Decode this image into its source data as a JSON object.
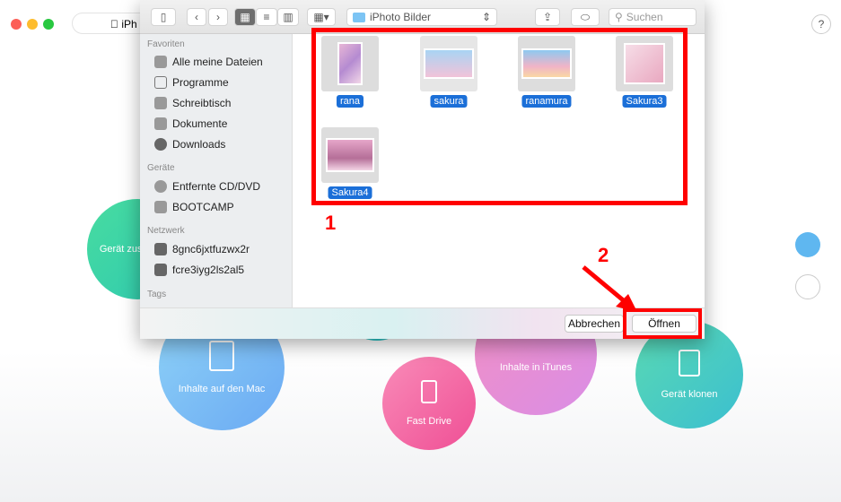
{
  "app": {
    "device_tab": "iPh",
    "help": "?"
  },
  "circles": [
    {
      "label": "Gerät zusammen",
      "color": "#3dd4a3"
    },
    {
      "label": "Inhalte auf den Mac",
      "color": "#7cc6f5"
    },
    {
      "label": "Fast Drive",
      "color": "#f46aa8"
    },
    {
      "label": "Inhalte in iTunes",
      "color": "#e98ad9"
    },
    {
      "label": "Gerät klonen",
      "color": "#4fd0b5"
    }
  ],
  "dialog": {
    "location": "iPhoto Bilder",
    "search_placeholder": "Suchen",
    "sidebar": {
      "favorites_header": "Favoriten",
      "favorites": [
        "Alle meine Dateien",
        "Programme",
        "Schreibtisch",
        "Dokumente",
        "Downloads"
      ],
      "devices_header": "Geräte",
      "devices": [
        "Entfernte CD/DVD",
        "BOOTCAMP"
      ],
      "network_header": "Netzwerk",
      "network": [
        "8gnc6jxtfuzwx2r",
        "fcre3iyg2ls2al5"
      ],
      "tags_header": "Tags"
    },
    "files": [
      "rana",
      "sakura",
      "ranamura",
      "Sakura3",
      "Sakura4"
    ],
    "cancel": "Abbrechen",
    "open": "Öffnen"
  },
  "annotations": {
    "step1": "1",
    "step2": "2",
    "color": "#ff0000"
  }
}
